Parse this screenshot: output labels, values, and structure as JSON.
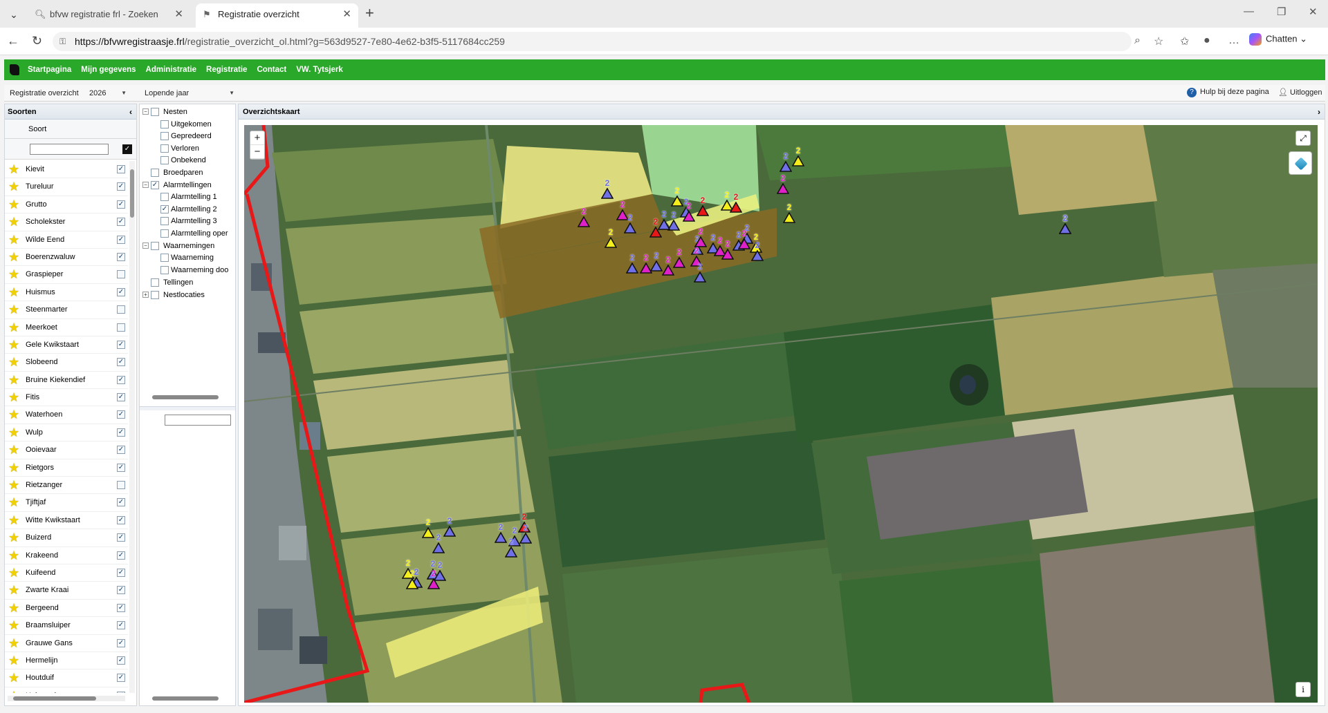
{
  "browser": {
    "tabs": [
      {
        "title": "bfvw registratie frl - Zoeken",
        "active": false
      },
      {
        "title": "Registratie overzicht",
        "active": true
      }
    ],
    "url_host": "https://bfvwregistraasje.frl",
    "url_path": "/registratie_overzicht_ol.html?g=563d9527-7e80-4e62-b3f5-5117684cc259",
    "chat_label": "Chatten"
  },
  "app": {
    "menu": [
      "Startpagina",
      "Mijn gegevens",
      "Administratie",
      "Registratie",
      "Contact",
      "VW. Tytsjerk"
    ],
    "toolbar": {
      "view_label": "Registratie overzicht",
      "year": "2026",
      "period": "Lopende jaar",
      "help": "Hulp bij deze pagina",
      "logout": "Uitloggen"
    },
    "species_panel": {
      "title": "Soorten",
      "column_header": "Soort",
      "items": [
        {
          "name": "Kievit",
          "checked": true
        },
        {
          "name": "Tureluur",
          "checked": true
        },
        {
          "name": "Grutto",
          "checked": true
        },
        {
          "name": "Scholekster",
          "checked": true
        },
        {
          "name": "Wilde Eend",
          "checked": true
        },
        {
          "name": "Boerenzwaluw",
          "checked": true
        },
        {
          "name": "Graspieper",
          "checked": false
        },
        {
          "name": "Huismus",
          "checked": true
        },
        {
          "name": "Steenmarter",
          "checked": false
        },
        {
          "name": "Meerkoet",
          "checked": false
        },
        {
          "name": "Gele Kwikstaart",
          "checked": true
        },
        {
          "name": "Slobeend",
          "checked": true
        },
        {
          "name": "Bruine Kiekendief",
          "checked": true
        },
        {
          "name": "Fitis",
          "checked": true
        },
        {
          "name": "Waterhoen",
          "checked": true
        },
        {
          "name": "Wulp",
          "checked": true
        },
        {
          "name": "Ooievaar",
          "checked": true
        },
        {
          "name": "Rietgors",
          "checked": true
        },
        {
          "name": "Rietzanger",
          "checked": false
        },
        {
          "name": "Tjiftjaf",
          "checked": true
        },
        {
          "name": "Witte Kwikstaart",
          "checked": true
        },
        {
          "name": "Buizerd",
          "checked": true
        },
        {
          "name": "Krakeend",
          "checked": true
        },
        {
          "name": "Kuifeend",
          "checked": true
        },
        {
          "name": "Zwarte Kraai",
          "checked": true
        },
        {
          "name": "Bergeend",
          "checked": true
        },
        {
          "name": "Braamsluiper",
          "checked": true
        },
        {
          "name": "Grauwe Gans",
          "checked": true
        },
        {
          "name": "Hermelijn",
          "checked": true
        },
        {
          "name": "Houtduif",
          "checked": true
        },
        {
          "name": "Huiszwaluw",
          "checked": true
        }
      ]
    },
    "tree": [
      {
        "label": "Nesten",
        "level": 0,
        "expand": "−",
        "checked": false
      },
      {
        "label": "Uitgekomen",
        "level": 1,
        "checked": false
      },
      {
        "label": "Gepredeerd",
        "level": 1,
        "checked": false
      },
      {
        "label": "Verloren",
        "level": 1,
        "checked": false
      },
      {
        "label": "Onbekend",
        "level": 1,
        "checked": false
      },
      {
        "label": "Broedparen",
        "level": 0,
        "checked": false
      },
      {
        "label": "Alarmtellingen",
        "level": 0,
        "expand": "−",
        "checked": true
      },
      {
        "label": "Alarmtelling 1",
        "level": 1,
        "checked": false
      },
      {
        "label": "Alarmtelling 2",
        "level": 1,
        "checked": true
      },
      {
        "label": "Alarmtelling 3",
        "level": 1,
        "checked": false
      },
      {
        "label": "Alarmtelling oper",
        "level": 1,
        "checked": false
      },
      {
        "label": "Waarnemingen",
        "level": 0,
        "expand": "−",
        "checked": false
      },
      {
        "label": "Waarneming",
        "level": 1,
        "checked": false
      },
      {
        "label": "Waarneming doo",
        "level": 1,
        "checked": false
      },
      {
        "label": "Tellingen",
        "level": 0,
        "checked": false
      },
      {
        "label": "Nestlocaties",
        "level": 0,
        "expand": "+",
        "checked": false
      }
    ],
    "map_panel": {
      "title": "Overzichtskaart",
      "zoom_in": "+",
      "zoom_out": "−",
      "info": "i"
    },
    "colors": {
      "nav_green": "#2aa82a",
      "marker_blue": "#6f6fe6",
      "marker_magenta": "#e020c8",
      "marker_yellow": "#f4ee1a",
      "marker_red": "#e81818",
      "boundary_red": "#e81818"
    },
    "markers": [
      {
        "color": "blue",
        "count": "2"
      },
      {
        "color": "magenta",
        "count": "2"
      },
      {
        "color": "magenta",
        "count": "2"
      },
      {
        "color": "blue",
        "count": "2"
      },
      {
        "color": "yellow",
        "count": "2"
      },
      {
        "color": "red",
        "count": "2"
      },
      {
        "color": "blue",
        "count": "2"
      },
      {
        "color": "yellow",
        "count": "2"
      },
      {
        "color": "blue",
        "count": "2"
      },
      {
        "color": "blue",
        "count": "2"
      },
      {
        "color": "magenta",
        "count": "2"
      },
      {
        "color": "red",
        "count": "2"
      },
      {
        "color": "yellow",
        "count": "2"
      },
      {
        "color": "red",
        "count": "2"
      },
      {
        "color": "blue",
        "count": "2"
      },
      {
        "color": "yellow",
        "count": "2"
      },
      {
        "color": "magenta",
        "count": "2"
      },
      {
        "color": "yellow",
        "count": "2"
      },
      {
        "color": "blue",
        "count": "2"
      },
      {
        "color": "magenta",
        "count": "2"
      },
      {
        "color": "blue",
        "count": "2"
      },
      {
        "color": "magenta",
        "count": "2"
      },
      {
        "color": "blue",
        "count": "2"
      },
      {
        "color": "magenta",
        "count": "2"
      },
      {
        "color": "magenta",
        "count": "2"
      },
      {
        "color": "blue",
        "count": "2"
      },
      {
        "color": "magenta",
        "count": "2"
      },
      {
        "color": "magenta",
        "count": "2"
      },
      {
        "color": "blue",
        "count": "2"
      },
      {
        "color": "blue",
        "count": "2"
      },
      {
        "color": "magenta",
        "count": "2"
      },
      {
        "color": "yellow",
        "count": "2"
      },
      {
        "color": "blue",
        "count": "2"
      },
      {
        "color": "blue",
        "count": "2"
      },
      {
        "color": "magenta",
        "count": "2"
      },
      {
        "color": "yellow",
        "count": "2"
      },
      {
        "color": "blue",
        "count": "2"
      },
      {
        "color": "blue",
        "count": "2"
      },
      {
        "color": "yellow",
        "count": "2"
      },
      {
        "color": "blue",
        "count": "2"
      },
      {
        "color": "blue",
        "count": "2"
      },
      {
        "color": "blue",
        "count": "2"
      },
      {
        "color": "red",
        "count": "2"
      },
      {
        "color": "blue",
        "count": "2"
      },
      {
        "color": "blue",
        "count": "2"
      },
      {
        "color": "blue",
        "count": "2"
      },
      {
        "color": "blue",
        "count": "2"
      },
      {
        "color": "magenta",
        "count": "2"
      },
      {
        "color": "blue",
        "count": "2"
      },
      {
        "color": "yellow",
        "count": "2"
      },
      {
        "color": "blue",
        "count": "2"
      }
    ]
  }
}
